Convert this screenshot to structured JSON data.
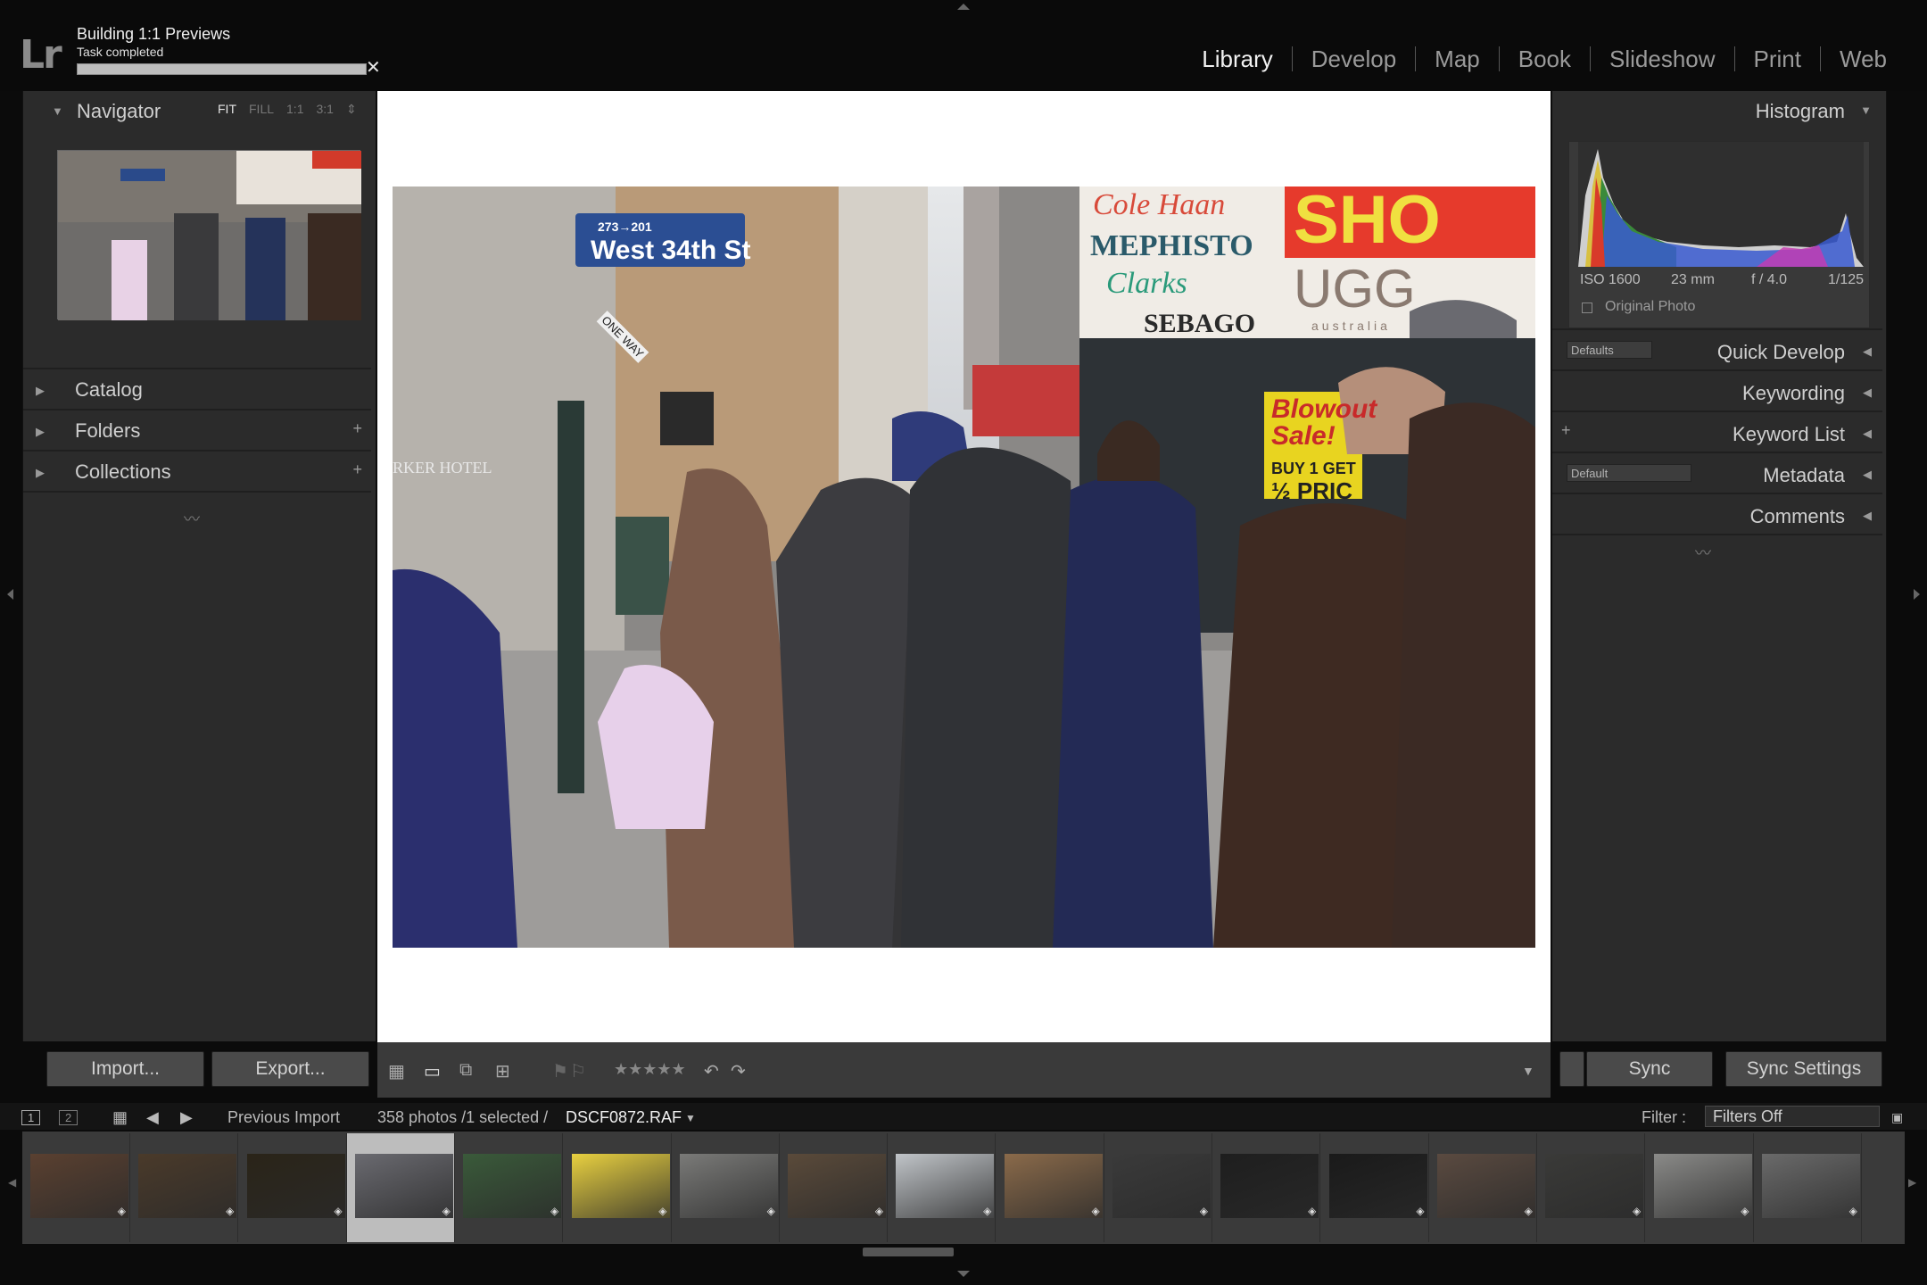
{
  "task": {
    "title": "Building 1:1 Previews",
    "status": "Task completed",
    "progress": 1.0
  },
  "app": {
    "logo": "Lr"
  },
  "modules": [
    {
      "label": "Library",
      "active": true
    },
    {
      "label": "Develop"
    },
    {
      "label": "Map"
    },
    {
      "label": "Book"
    },
    {
      "label": "Slideshow"
    },
    {
      "label": "Print"
    },
    {
      "label": "Web"
    }
  ],
  "left": {
    "navigator": {
      "label": "Navigator",
      "opts": [
        "FIT",
        "FILL",
        "1:1",
        "3:1"
      ],
      "active_opt": "FIT"
    },
    "catalog": "Catalog",
    "folders": "Folders",
    "collections": "Collections",
    "import_label": "Import...",
    "export_label": "Export..."
  },
  "photo": {
    "sign": {
      "route": "273→201",
      "street": "West 34th St"
    },
    "store_signs": [
      "Cole Haan",
      "MEPHISTO",
      "Clarks",
      "SEBAGO",
      "UGG",
      "australia",
      "SHO",
      "Blowout Sale!",
      "BUY 1 GET",
      "½ PRIC"
    ],
    "hotel": "RKER HOTEL",
    "one_way": "ONE WAY"
  },
  "right": {
    "histogram": "Histogram",
    "exif": {
      "iso": "ISO 1600",
      "focal": "23 mm",
      "aperture": "f / 4.0",
      "shutter": "1/125"
    },
    "original_photo": "Original Photo",
    "quick_develop": "Quick Develop",
    "quick_develop_preset": "Defaults",
    "keywording": "Keywording",
    "keyword_list": "Keyword List",
    "metadata": "Metadata",
    "metadata_preset": "Default",
    "comments": "Comments",
    "sync_label": "Sync",
    "sync_settings_label": "Sync Settings"
  },
  "filmbar": {
    "page1": "1",
    "page2": "2",
    "source": "Previous Import",
    "count": "358 photos /1 selected /",
    "filename": "DSCF0872.RAF",
    "filter_label": "Filter :",
    "filter_value": "Filters Off"
  },
  "thumbnails": [
    "#5a4030",
    "#4a3a2a",
    "#2a2418",
    "#6a6a70",
    "#3a5a3a",
    "#e8d040",
    "#7a7a78",
    "#5a4a3a",
    "#c0c4c8",
    "#8a6a4a",
    "#3a3a3a",
    "#1e1e1e",
    "#1a1a1a",
    "#5a4a40",
    "#3a3a38",
    "#8a8a88",
    "#6a6a6a"
  ],
  "selected_thumb": 3
}
